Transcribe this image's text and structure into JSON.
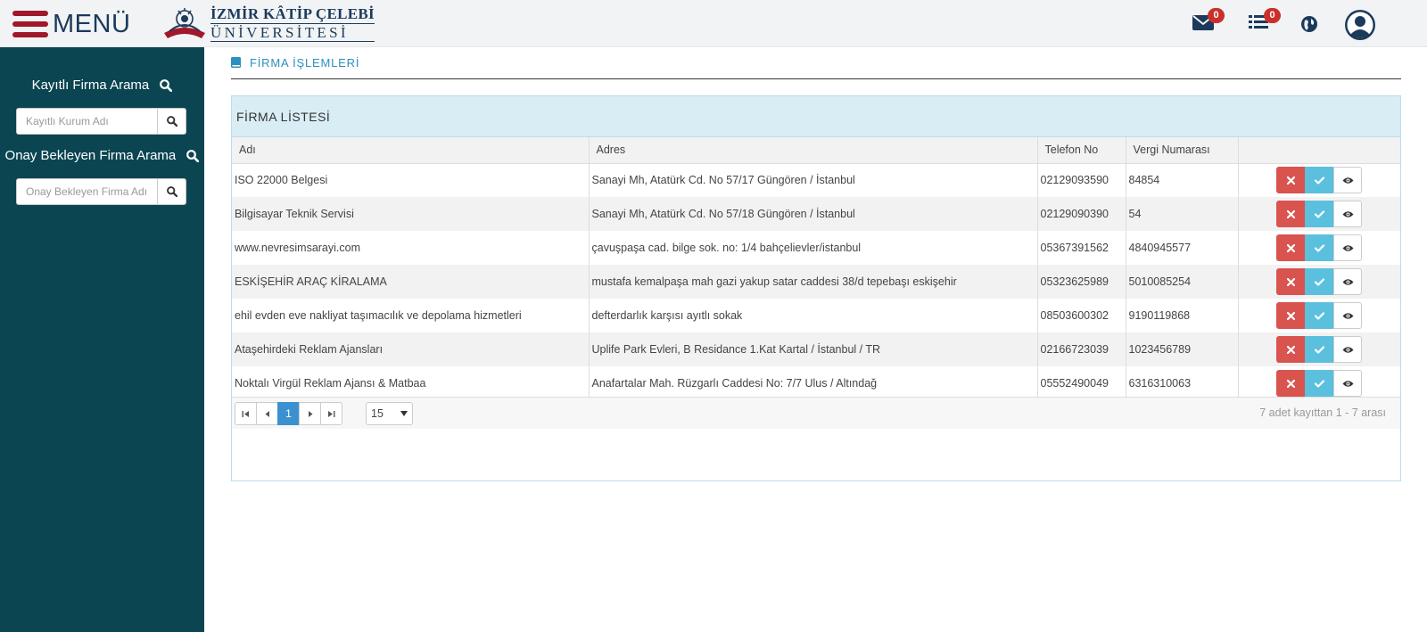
{
  "header": {
    "menu_label": "MENÜ",
    "logo_line1": "İZMİR KÂTİP ÇELEBİ",
    "logo_line2": "ÜNİVERSİTESİ",
    "mail_count": "0",
    "list_count": "0",
    "icons": [
      "envelope-icon",
      "list-icon",
      "globe-icon",
      "user-avatar-icon"
    ],
    "badge_color": "#c9302c"
  },
  "sidebar": {
    "bg_color": "#0b4552",
    "search1": {
      "title": "Kayıtlı Firma Arama",
      "placeholder": "Kayıtlı Kurum Adı"
    },
    "search2": {
      "title": "Onay Bekleyen Firma Arama",
      "placeholder": "Onay Bekleyen Firma Adı"
    }
  },
  "breadcrumb": {
    "label": "FİRMA İŞLEMLERİ"
  },
  "panel": {
    "title": "FİRMA LİSTESİ",
    "columns": [
      "Adı",
      "Adres",
      "Telefon No",
      "Vergi Numarası",
      ""
    ],
    "rows": [
      {
        "name": "ISO 22000 Belgesi",
        "address": "Sanayi Mh, Atatürk Cd. No 57/17 Güngören / İstanbul",
        "phone": "02129093590",
        "tax": "84854"
      },
      {
        "name": "Bilgisayar Teknik Servisi",
        "address": "Sanayi Mh, Atatürk Cd. No 57/18 Güngören / İstanbul",
        "phone": "02129090390",
        "tax": "54"
      },
      {
        "name": "www.nevresimsarayi.com",
        "address": "çavuşpaşa cad. bilge sok. no: 1/4 bahçelievler/istanbul",
        "phone": "05367391562",
        "tax": "4840945577"
      },
      {
        "name": "ESKİŞEHİR ARAÇ KİRALAMA",
        "address": "mustafa kemalpaşa mah gazi yakup satar caddesi 38/d tepebaşı eskişehir",
        "phone": "05323625989",
        "tax": "5010085254"
      },
      {
        "name": "ehil evden eve nakliyat taşımacılık ve depolama hizmetleri",
        "address": "defterdarlık karşısı ayıtlı sokak",
        "phone": "08503600302",
        "tax": "9190119868"
      },
      {
        "name": "Ataşehirdeki Reklam Ajansları",
        "address": "Uplife Park Evleri, B Residance 1.Kat Kartal / İstanbul / TR",
        "phone": "02166723039",
        "tax": "1023456789"
      },
      {
        "name": "Noktalı Virgül Reklam Ajansı & Matbaa",
        "address": "Anafartalar Mah. Rüzgarlı Caddesi No: 7/7 Ulus / Altındağ",
        "phone": "05552490049",
        "tax": "6316310063"
      }
    ],
    "row_actions": [
      "delete-icon",
      "check-icon",
      "eye-icon"
    ],
    "action_colors": {
      "delete": "#d9534f",
      "approve": "#5bc0de"
    }
  },
  "pager": {
    "current_page": "1",
    "page_size": "15",
    "info": "7 adet kayıttan 1 - 7 arası",
    "active_color": "#3b91cf"
  }
}
